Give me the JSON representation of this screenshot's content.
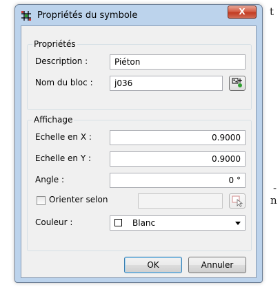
{
  "background_text": {
    "line1": "t",
    "line2": "-",
    "line3": "n"
  },
  "window": {
    "title": "Propriétés du symbole",
    "close_label": "X"
  },
  "properties_group": {
    "title": "Propriétés",
    "description_label": "Description :",
    "description_value": "Piéton",
    "block_name_label": "Nom du bloc :",
    "block_name_value": "j036"
  },
  "display_group": {
    "title": "Affichage",
    "scale_x_label": "Echelle en X :",
    "scale_x_value": "0.9000",
    "scale_y_label": "Echelle en Y :",
    "scale_y_value": "0.9000",
    "angle_label": "Angle :",
    "angle_value": "0 °",
    "orient_label": "Orienter selon",
    "orient_checked": false,
    "orient_value": "",
    "color_label": "Couleur :",
    "color_value": "Blanc",
    "color_swatch": "#ffffff"
  },
  "buttons": {
    "ok": "OK",
    "cancel": "Annuler"
  },
  "colors": {
    "title_bar": "#bcd3ec",
    "close_button": "#c94a33",
    "client_bg": "#f0f0f0",
    "default_button_border": "#3c7fb1"
  }
}
